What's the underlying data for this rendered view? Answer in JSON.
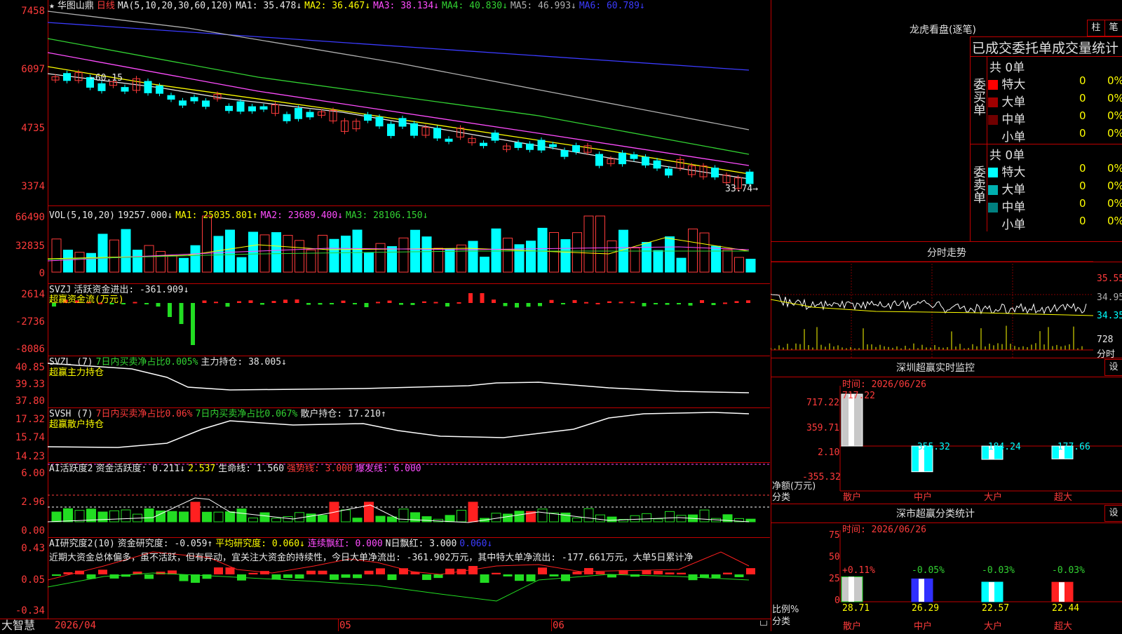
{
  "main": {
    "title_star": "★",
    "stock_name": "华图山鼎",
    "period": "日线",
    "ma_params": "MA(5,10,20,30,60,120)",
    "ma": [
      {
        "label": "MA1: 35.478↓",
        "color": "#e8e8e8"
      },
      {
        "label": "MA2: 36.467↓",
        "color": "#ffff00"
      },
      {
        "label": "MA3: 38.134↓",
        "color": "#ff4dff"
      },
      {
        "label": "MA4: 40.830↓",
        "color": "#32d232"
      },
      {
        "label": "MA5: 46.993↓",
        "color": "#b0b0b0"
      },
      {
        "label": "MA6: 60.789↓",
        "color": "#3b3bff"
      }
    ],
    "y_labels": [
      "7458",
      "6097",
      "4735",
      "3374"
    ],
    "high_mark": "60.15",
    "low_mark": "33.74"
  },
  "vol": {
    "header": "VOL(5,10,20)",
    "value": "19257.000↓",
    "ma1": "MA1: 25035.801↑",
    "ma2": "MA2: 23689.400↓",
    "ma3": "MA3: 28106.150↓",
    "y_labels": [
      "66490",
      "32835",
      "0"
    ]
  },
  "svzj": {
    "header": "SVZJ",
    "label": "活跃资金进出: -361.909↓",
    "subtitle": "超赢资金流(万元)",
    "y_labels": [
      "2614",
      "-2736",
      "-8086"
    ]
  },
  "svzl": {
    "header": "SVZL (7)",
    "net": "7日内买卖净占比0.005%",
    "hold": "主力持仓: 38.005↓",
    "subtitle": "超赢主力持仓",
    "y_labels": [
      "40.85",
      "39.33",
      "37.80"
    ]
  },
  "svsh": {
    "header": "SVSH (7)",
    "net1": "7日内买卖净占比0.06%",
    "net2": "7日内买卖净占比0.067%",
    "hold": "散户持仓: 17.210↑",
    "subtitle": "超赢散户持仓",
    "y_labels": [
      "17.32",
      "15.74",
      "14.23"
    ]
  },
  "ai_active": {
    "header": "AI活跃度2",
    "active": "资金活跃度: 0.211↓",
    "v2": "2.537",
    "life": "生命线: 1.560",
    "strong": "强势线: 3.000",
    "burst": "爆发线: 6.000",
    "y_labels": [
      "6.00",
      "2.96",
      "0.00"
    ]
  },
  "ai_research": {
    "header": "AI研究度2(10)",
    "research": "资金研究度: -0.059↑",
    "avg": "平均研究度: 0.060↓",
    "cont": "连续飘红: 0.000",
    "nday": "N日飘红: 3.000",
    "last": "0.060↓",
    "comment": "近期大资金总体偏多，虽不活跃，但有异动，宜关注大资金的持续性，今日大单净流出: -361.902万元，其中特大单净流出: -177.661万元，大单5日累计净",
    "y_labels": [
      "0.43",
      "0.05",
      "-0.34"
    ]
  },
  "x_axis": {
    "start": "2026/04",
    "m1": "05",
    "m2": "06"
  },
  "footer_logo": "大智慧",
  "dragon": {
    "title": "龙虎看盘(逐笔)",
    "btn1": "柱",
    "btn2": "笔",
    "header": "已成交委托单成交量统计",
    "buy_label": "委买单",
    "sell_label": "委卖单",
    "buy_total": "共 0单",
    "sell_total": "共 0单",
    "buy_rows": [
      {
        "name": "特大",
        "n": "0",
        "pct": "0%",
        "color": "#ff0000"
      },
      {
        "name": "大单",
        "n": "0",
        "pct": "0%",
        "color": "#a00000"
      },
      {
        "name": "中单",
        "n": "0",
        "pct": "0%",
        "color": "#700000"
      },
      {
        "name": "小单",
        "n": "0",
        "pct": "0%",
        "color": "#000000"
      }
    ],
    "sell_rows": [
      {
        "name": "特大",
        "n": "0",
        "pct": "0%",
        "color": "#00ffff"
      },
      {
        "name": "大单",
        "n": "0",
        "pct": "0%",
        "color": "#00b0b0"
      },
      {
        "name": "中单",
        "n": "0",
        "pct": "0%",
        "color": "#008080"
      },
      {
        "name": "小单",
        "n": "0",
        "pct": "0%",
        "color": "#000000"
      }
    ]
  },
  "intraday": {
    "title": "分时走势",
    "prices": [
      "35.55",
      "34.95",
      "34.35"
    ],
    "vol": "728",
    "vol_label": "分时"
  },
  "monitor": {
    "title": "深圳超赢实时监控",
    "btn": "设",
    "date": "时间: 2026/06/26",
    "y_labels": [
      "717.22",
      "359.71",
      "2.10",
      "-355.32"
    ],
    "y_caption": "净额(万元)",
    "x_caption": "分类",
    "categories": [
      "散户",
      "中户",
      "大户",
      "超大"
    ],
    "values": [
      "717.22",
      "-355.32",
      "-184.24",
      "-177.66"
    ]
  },
  "classify": {
    "title": "深市超赢分类统计",
    "btn": "设",
    "date": "时间: 2026/06/26",
    "y_labels": [
      "75",
      "50",
      "25",
      "0"
    ],
    "y_caption": "比例%",
    "x_caption": "分类",
    "categories": [
      "散户",
      "中户",
      "大户",
      "超大"
    ],
    "changes": [
      "+0.11%",
      "-0.05%",
      "-0.03%",
      "-0.03%"
    ],
    "values": [
      "28.71",
      "26.29",
      "22.57",
      "22.44"
    ]
  }
}
